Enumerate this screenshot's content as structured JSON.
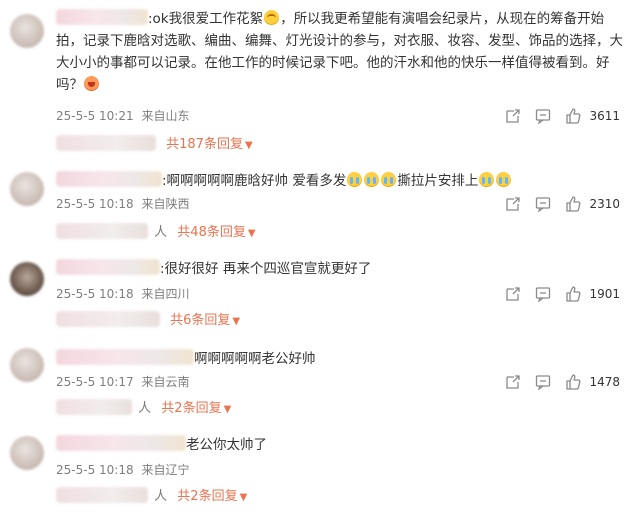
{
  "comments": [
    {
      "text_line1": ":ok我很爱工作花絮",
      "text_line1b": "，所以我更希望能有演唱会纪录片，从现在的筹备开始",
      "text_line2": "拍，记录下鹿晗对选歌、编曲、编舞、灯光设计的参与，对衣服、妆容、发型、饰品的选择，大",
      "text_line3": "大小小的事都可以记录。在他工作的时候记录下吧。他的汗水和他的快乐一样值得被看到。好",
      "text_line4": "吗？",
      "timestamp": "25-5-5 10:21",
      "location": "来自山东",
      "likes": "3611",
      "replies": "共187条回复"
    },
    {
      "text_a": ":啊啊啊啊啊鹿晗好帅 爱看多发",
      "text_b": "撕拉片安排上",
      "timestamp": "25-5-5 10:18",
      "location": "来自陕西",
      "likes": "2310",
      "reply_person": "人",
      "replies": "共48条回复"
    },
    {
      "text": ":很好很好 再来个四巡官宣就更好了",
      "timestamp": "25-5-5 10:18",
      "location": "来自四川",
      "likes": "1901",
      "reply_person": "人",
      "replies": "共6条回复"
    },
    {
      "text": "啊啊啊啊啊老公好帅",
      "timestamp": "25-5-5 10:17",
      "location": "来自云南",
      "likes": "1478",
      "reply_person": "人",
      "replies": "共2条回复"
    },
    {
      "text": "老公你太帅了",
      "timestamp": "25-5-5 10:18",
      "location": "来自辽宁",
      "likes": "",
      "reply_person": "人",
      "replies": "共2条回复"
    }
  ],
  "icons": {
    "share": "share-icon",
    "comment": "comment-icon",
    "like": "like-icon",
    "more": "chevron-down-icon"
  },
  "colors": {
    "accent": "#eb7350",
    "meta": "#7f7f7f"
  }
}
